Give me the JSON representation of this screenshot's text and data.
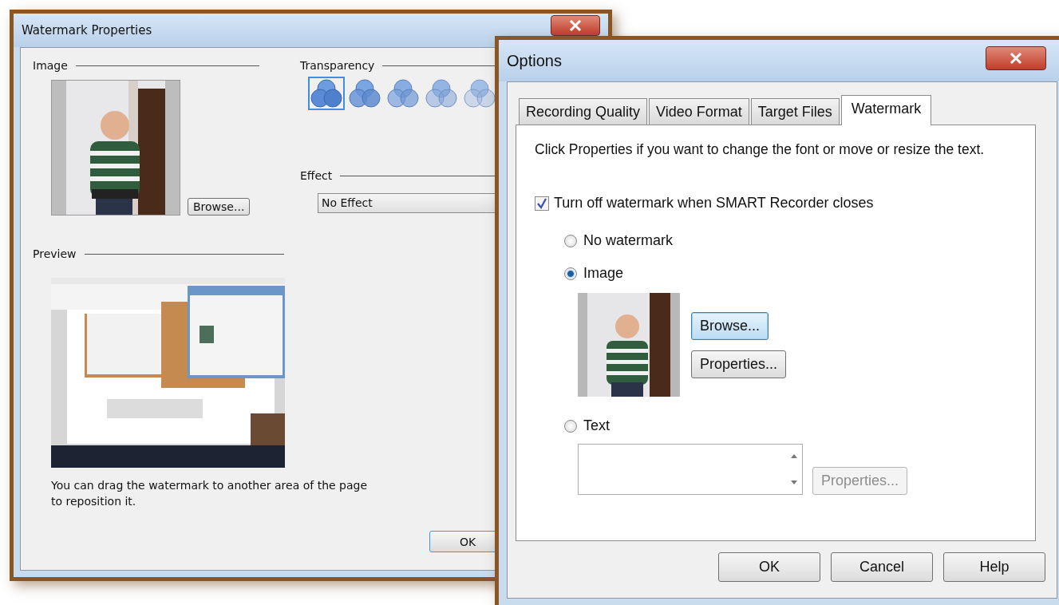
{
  "watermark_properties": {
    "title": "Watermark Properties",
    "image_section": {
      "label": "Image",
      "picture": {
        "kind": "picture"
      },
      "browse_button": "Browse..."
    },
    "transparency": {
      "label": "Transparency",
      "options": [
        {
          "selected": true
        },
        {
          "selected": false
        },
        {
          "selected": false
        },
        {
          "selected": false
        },
        {
          "selected": false
        }
      ]
    },
    "effect": {
      "label": "Effect",
      "value": "No Effect"
    },
    "preview": {
      "label": "Preview",
      "picture": {
        "kind": "picture"
      },
      "caption": "You can drag the watermark to another area of the page to reposition it."
    },
    "ok_button": "OK"
  },
  "options": {
    "title": "Options",
    "tabs": [
      {
        "label": "Recording Quality",
        "selected": false
      },
      {
        "label": "Video Format",
        "selected": false
      },
      {
        "label": "Target Files",
        "selected": false
      },
      {
        "label": "Watermark",
        "selected": true
      }
    ],
    "instruction": "Click Properties if you want to change the font or move or resize the text.",
    "turn_off_checkbox": {
      "label": "Turn off watermark when SMART Recorder closes",
      "checked": true
    },
    "radios": [
      {
        "label": "No watermark",
        "selected": false
      },
      {
        "label": "Image",
        "selected": true
      },
      {
        "label": "Text",
        "selected": false
      }
    ],
    "image_picture": {
      "kind": "picture"
    },
    "image_browse_button": {
      "label": "Browse...",
      "disabled": false
    },
    "image_properties_button": {
      "label": "Properties...",
      "disabled": false
    },
    "text_properties_button": {
      "label": "Properties...",
      "disabled": true
    },
    "buttons": [
      "OK",
      "Cancel",
      "Help"
    ]
  }
}
